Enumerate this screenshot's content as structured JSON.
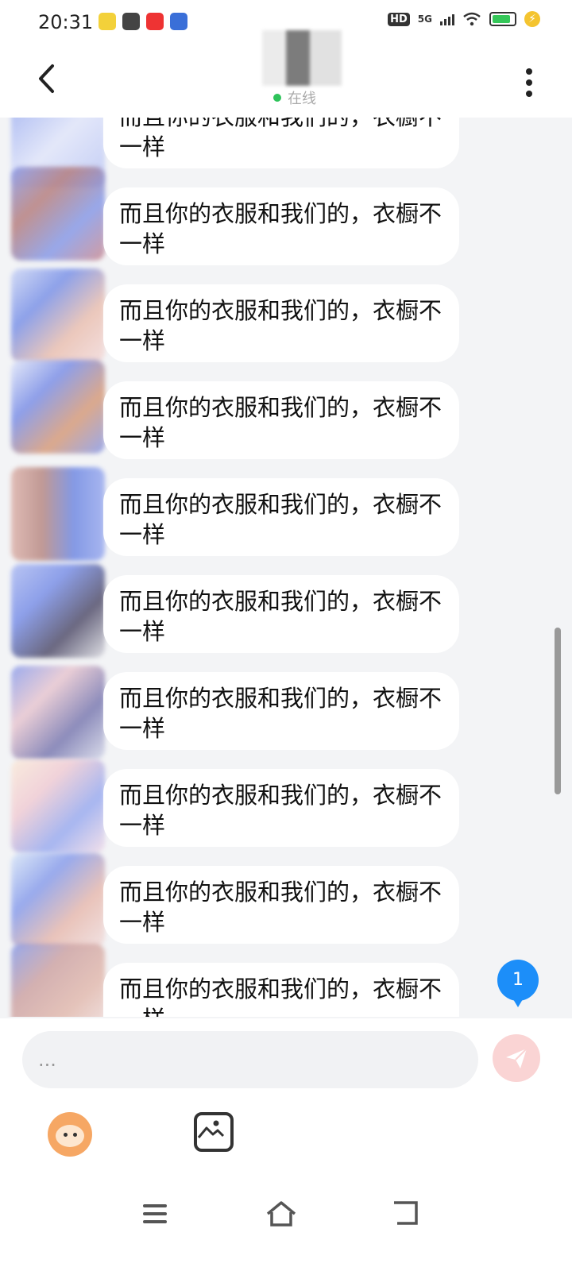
{
  "status_bar": {
    "time": "20:31",
    "hd_label": "HD",
    "network_label": "5G"
  },
  "header": {
    "presence": "在线"
  },
  "messages": [
    {
      "text": "而且你的衣服和我们的，衣橱不一样"
    },
    {
      "text": "而且你的衣服和我们的，衣橱不一样"
    },
    {
      "text": "而且你的衣服和我们的，衣橱不一样"
    },
    {
      "text": "而且你的衣服和我们的，衣橱不一样"
    },
    {
      "text": "而且你的衣服和我们的，衣橱不一样"
    },
    {
      "text": "而且你的衣服和我们的，衣橱不一样"
    },
    {
      "text": "而且你的衣服和我们的，衣橱不一样"
    },
    {
      "text": "而且你的衣服和我们的，衣橱不一样"
    },
    {
      "text": "而且你的衣服和我们的，衣橱不一样"
    },
    {
      "text": "而且你的衣服和我们的，衣橱不一样"
    }
  ],
  "unread_count": "1",
  "composer": {
    "placeholder": "..."
  },
  "colors": {
    "accent_blue": "#1c8ef9",
    "online_green": "#2ec35a",
    "send_button": "#fad4d4",
    "background": "#f3f4f6"
  },
  "icons": [
    "back-arrow-icon",
    "more-vertical-icon",
    "send-icon",
    "emoji-icon",
    "image-icon",
    "menu-icon",
    "home-icon",
    "back-nav-icon"
  ]
}
